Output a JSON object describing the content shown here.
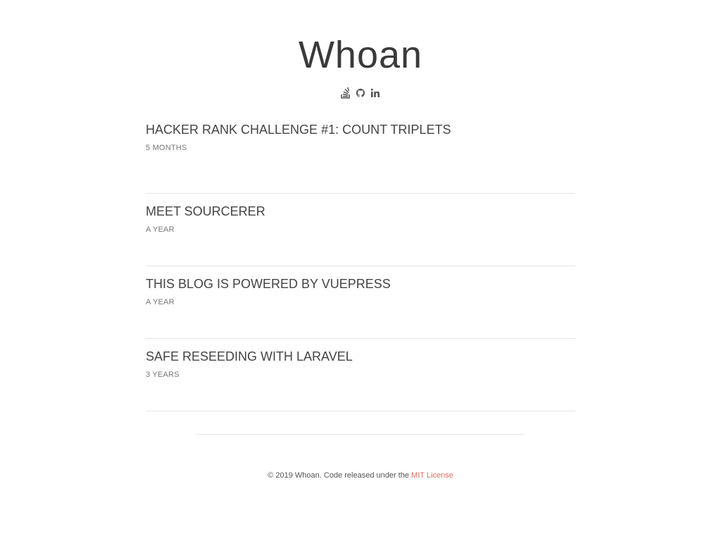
{
  "site": {
    "title": "Whoan"
  },
  "social": [
    {
      "icon": "stack-overflow-icon",
      "label": "Stack Overflow"
    },
    {
      "icon": "github-icon",
      "label": "GitHub"
    },
    {
      "icon": "linkedin-icon",
      "label": "LinkedIn"
    }
  ],
  "posts": [
    {
      "title": "HACKER RANK CHALLENGE #1: COUNT TRIPLETS",
      "date": "5 MONTHS"
    },
    {
      "title": "MEET SOURCERER",
      "date": "A YEAR"
    },
    {
      "title": "THIS BLOG IS POWERED BY VUEPRESS",
      "date": "A YEAR"
    },
    {
      "title": "SAFE RESEEDING WITH LARAVEL",
      "date": "3 YEARS"
    }
  ],
  "footer": {
    "text": "© 2019 Whoan. Code released under the ",
    "link_label": "MIT License",
    "link_color": "#e46d62"
  },
  "colors": {
    "text": "#444444",
    "divider": "#e5e5e5",
    "accent": "#e46d62"
  }
}
